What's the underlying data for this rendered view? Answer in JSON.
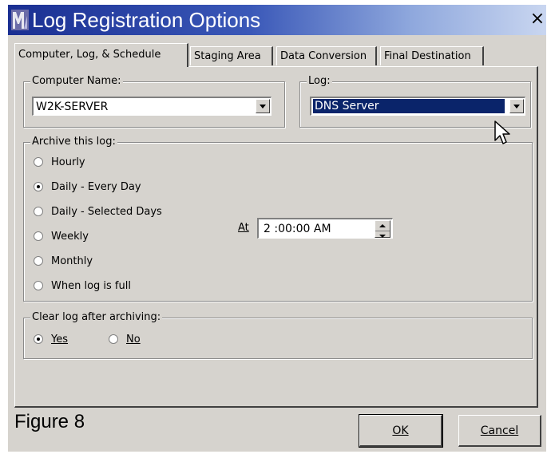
{
  "window": {
    "title": "Log Registration Options",
    "close_glyph": "×"
  },
  "tabs": [
    {
      "label": "Computer, Log, & Schedule",
      "active": true
    },
    {
      "label": "Staging Area",
      "active": false
    },
    {
      "label": "Data Conversion",
      "active": false
    },
    {
      "label": "Final Destination",
      "active": false
    }
  ],
  "computer": {
    "label": "Computer Name:",
    "value": "W2K-SERVER"
  },
  "log": {
    "label": "Log:",
    "value": "DNS Server"
  },
  "archive": {
    "label": "Archive this log:",
    "options": [
      {
        "label": "Hourly",
        "checked": false
      },
      {
        "label": "Daily - Every Day",
        "checked": true
      },
      {
        "label": "Daily - Selected Days",
        "checked": false
      },
      {
        "label": "Weekly",
        "checked": false
      },
      {
        "label": "Monthly",
        "checked": false
      },
      {
        "label": "When log is full",
        "checked": false
      }
    ],
    "at_label": "At",
    "time_value": "2 :00:00 AM"
  },
  "clear": {
    "label": "Clear log after archiving:",
    "yes_label": "Yes",
    "no_label": "No",
    "selected": "Yes"
  },
  "footer": {
    "figure_label": "Figure 8",
    "ok_label": "OK",
    "cancel_label": "Cancel"
  },
  "colors": {
    "titlebar_start": "#1a2f92",
    "selection": "#0a246a",
    "dialog_face": "#d6d3ce"
  },
  "icons": {
    "app": "log-app-icon",
    "close": "close-icon",
    "dropdown": "chevron-down-icon",
    "cursor": "mouse-pointer-icon"
  }
}
